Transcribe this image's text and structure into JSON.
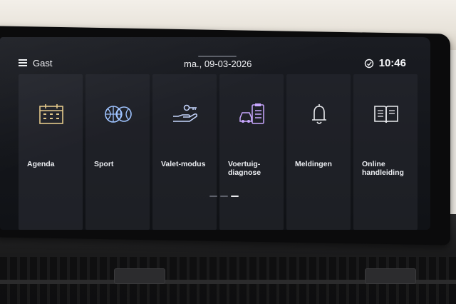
{
  "header": {
    "menu_label": "Gast",
    "date": "ma., 09-03-2026",
    "time": "10:46",
    "status_icon": "connectivity-icon"
  },
  "tiles": [
    {
      "label": "Agenda",
      "icon": "calendar-icon"
    },
    {
      "label": "Sport",
      "icon": "sport-balls-icon"
    },
    {
      "label": "Valet-modus",
      "icon": "key-hand-icon"
    },
    {
      "label": "Voertuig-\ndiagnose",
      "icon": "car-diagnose-icon"
    },
    {
      "label": "Meldingen",
      "icon": "bell-icon"
    },
    {
      "label": "Online\nhandleiding",
      "icon": "book-icon"
    }
  ],
  "pager": {
    "pages": 3,
    "current": 3
  },
  "colors": {
    "screen_bg": "#14161b",
    "agenda_accent": "#e3c889",
    "sport_accent": "#9ec3ff",
    "valet_accent": "#c7d7ff",
    "diagnose_accent": "#c9a7ff",
    "text": "#e9eaee"
  }
}
